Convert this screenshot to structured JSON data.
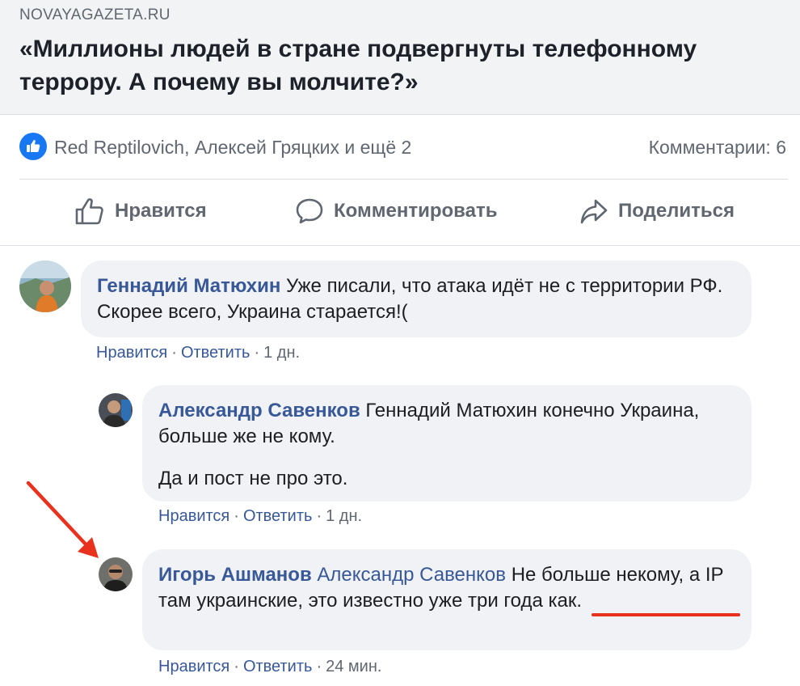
{
  "preview": {
    "domain": "NOVAYAGAZETA.RU",
    "title": "«Миллионы людей в стране подвергнуты телефонному террору. А почему вы молчите?»"
  },
  "reactions": {
    "likers": "Red Reptilovich, Алексей Гряцких и ещё 2",
    "comments_label": "Комментарии: 6"
  },
  "actions": {
    "like": "Нравится",
    "comment": "Комментировать",
    "share": "Поделиться"
  },
  "comments": [
    {
      "author": "Геннадий Матюхин",
      "text": " Уже писали, что атака идёт не с территории РФ. Скорее всего, Украина старается!(",
      "like": "Нравится",
      "reply": "Ответить",
      "time": "1 дн."
    },
    {
      "author": "Александр Савенков",
      "text": " Геннадий Матюхин конечно Украина, больше же не кому.",
      "text2": "Да и пост не про это.",
      "like": "Нравится",
      "reply": "Ответить",
      "time": "1 дн."
    },
    {
      "author": "Игорь Ашманов",
      "mention": " Александр Савенков",
      "text": " Не больше некому, а IP там украинские, это известно уже три года как.",
      "like": "Нравится",
      "reply": "Ответить",
      "time": "24 мин."
    }
  ],
  "colors": {
    "link": "#385898",
    "like_badge": "#1877f2",
    "annotation": "#e8321e"
  }
}
